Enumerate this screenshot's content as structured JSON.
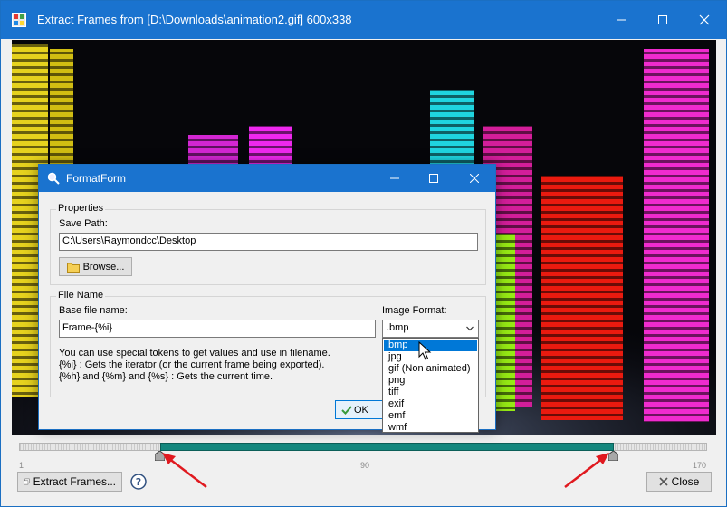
{
  "main": {
    "title": "Extract Frames from [D:\\Downloads\\animation2.gif] 600x338",
    "extract_label": "Extract Frames...",
    "close_label": "Close",
    "timeline": {
      "tick_start": "1",
      "tick_mid": "90",
      "tick_end": "170"
    }
  },
  "form": {
    "title": "FormatForm",
    "properties_title": "Properties",
    "save_path_label": "Save Path:",
    "save_path_value": "C:\\Users\\Raymondcc\\Desktop",
    "browse_label": "Browse...",
    "file_name_title": "File Name",
    "base_file_name_label": "Base file name:",
    "base_file_name_value": "Frame-{%i}",
    "image_format_label": "Image Format:",
    "image_format_value": ".bmp",
    "hint_line1": "You can use special tokens to get values and use in filename.",
    "hint_line2": "{%i} : Gets the iterator (or the current frame being exported).",
    "hint_line3": "{%h} and {%m} and {%s} : Gets the current time.",
    "ok_label": "OK",
    "format_options": [
      ".bmp",
      ".jpg",
      ".gif (Non animated)",
      ".png",
      ".tiff",
      ".exif",
      ".emf",
      ".wmf"
    ]
  },
  "colors": {
    "titlebar": "#1a73cf",
    "selection": "#0078d7",
    "range": "#14877e",
    "arrow": "#e0191f"
  }
}
